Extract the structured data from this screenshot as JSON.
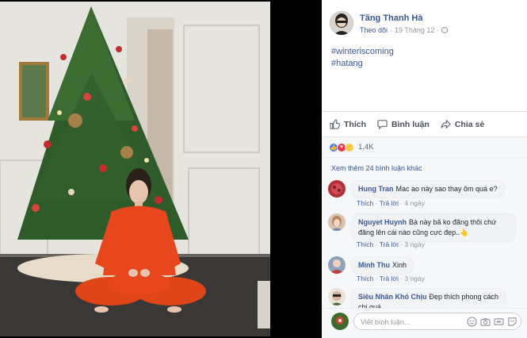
{
  "post": {
    "author": "Tăng Thanh Hà",
    "follow_label": "Theo dõi",
    "separator": "·",
    "date": "19 Tháng 12 ·",
    "hashtags": [
      "#winteriscoming",
      "#hatang"
    ]
  },
  "actions": {
    "like": "Thích",
    "comment": "Bình luận",
    "share": "Chia sẻ"
  },
  "reactions": {
    "count": "1,4K",
    "types": [
      "like-icon",
      "love-icon",
      "haha-icon"
    ],
    "colors": {
      "like": "#4a7bf0",
      "love": "#f0334b",
      "haha": "#f7c948"
    }
  },
  "comments": {
    "more_label": "Xem thêm 24 bình luận khác",
    "like_label": "Thích",
    "reply_label": "Trả lời",
    "dot": "·",
    "items": [
      {
        "name": "Hung Tran",
        "text": "Mac ao này sao thay ôm quá e?",
        "time": "4 ngày"
      },
      {
        "name": "Nguyet Huynh",
        "text": "Bà này bã ko đăng thôi chứ đăng lên cái nào cũng cực đẹp..👆",
        "time": "3 ngày"
      },
      {
        "name": "Minh Thu",
        "text": "Xinh",
        "time": "3 ngày"
      },
      {
        "name": "Siêu Nhân Khó Chịu",
        "text": "Đẹp thích phong cách chị quá",
        "time": ""
      }
    ]
  },
  "composer": {
    "placeholder": "Viết bình luận..."
  },
  "colors": {
    "link": "#385898",
    "pajama": "#e8461d",
    "panel_bg": "#f6f7f9"
  }
}
